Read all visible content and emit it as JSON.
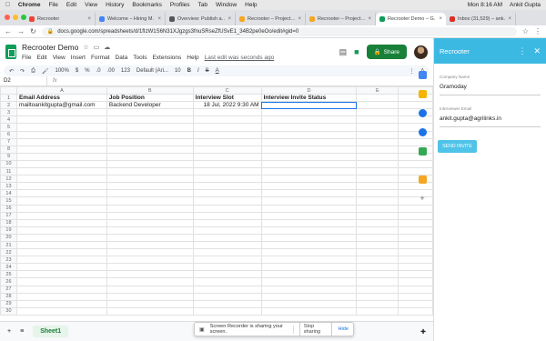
{
  "mac_menu": {
    "apple": "",
    "app": "Chrome",
    "items": [
      "File",
      "Edit",
      "View",
      "History",
      "Bookmarks",
      "Profiles",
      "Tab",
      "Window",
      "Help"
    ],
    "clock": "Mon 8:16 AM",
    "user": "Ankit Gupta"
  },
  "tabs": [
    {
      "label": "Recrooter",
      "color": "#e9463a",
      "active": false
    },
    {
      "label": "Welcome – Hiring M…",
      "color": "#4285f4",
      "active": false
    },
    {
      "label": "Overview: Publish a…",
      "color": "#555555",
      "active": false
    },
    {
      "label": "Recrooter – Project…",
      "color": "#f5a623",
      "active": false
    },
    {
      "label": "Recrooter – Project…",
      "color": "#f5a623",
      "active": false
    },
    {
      "label": "Recrooter Demo – G…",
      "color": "#0f9d58",
      "active": true
    },
    {
      "label": "Inbox (31,529) – ank…",
      "color": "#d93025",
      "active": false
    }
  ],
  "url": "docs.google.com/spreadsheets/d/1fIzW1S6N31XJgzgs3fnuSRseZfUSvE1_34B2pe0eOo/edit#gid=0",
  "doc": {
    "title": "Recrooter Demo",
    "menus": [
      "File",
      "Edit",
      "View",
      "Insert",
      "Format",
      "Data",
      "Tools",
      "Extensions",
      "Help"
    ],
    "last_edit": "Last edit was seconds ago",
    "share_label": "Share"
  },
  "toolbar": {
    "zoom": "100%",
    "currency": "$",
    "percent": "%",
    "dec1": ".0",
    "dec2": ".00",
    "numfmt": "123",
    "font": "Default (Ari...",
    "size": "10"
  },
  "cell_ref": "D2",
  "grid": {
    "columns": [
      "A",
      "B",
      "C",
      "D",
      "E"
    ],
    "rows": [
      [
        "Email Address",
        "Job Position",
        "Interview Slot",
        "Interview Invite Status",
        ""
      ],
      [
        "mailtoankitgupta@gmail.com",
        "Backend Developer",
        "18 Jul, 2022 9:30 AM",
        "",
        ""
      ]
    ],
    "row_count": 30
  },
  "sheet_tab": "Sheet1",
  "screen_notice": {
    "text": "Screen Recorder is sharing your screen.",
    "stop": "Stop sharing",
    "hide": "Hide"
  },
  "panel": {
    "title": "Recrooter",
    "company_label": "Company Name",
    "company_value": "Gramoday",
    "email_label": "Interviewer Email",
    "email_value": "ankit.gupta@agrilinks.in",
    "send_label": "SEND INVITE"
  }
}
